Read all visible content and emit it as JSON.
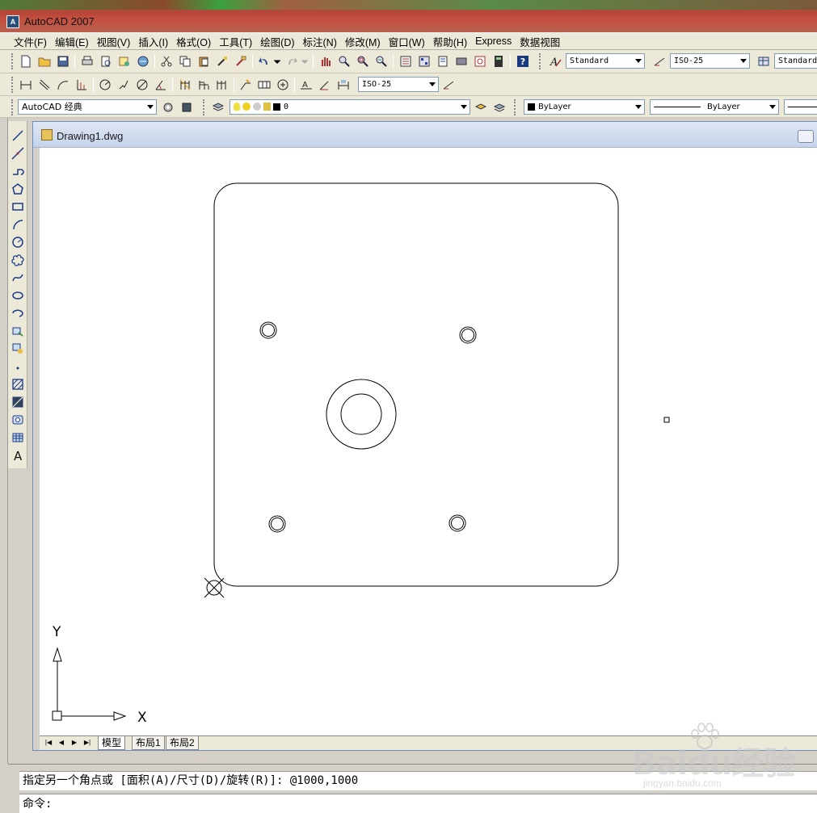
{
  "app": {
    "title": "AutoCAD 2007",
    "icon_name": "autocad-icon"
  },
  "menu": {
    "items": [
      "文件(F)",
      "编辑(E)",
      "视图(V)",
      "插入(I)",
      "格式(O)",
      "工具(T)",
      "绘图(D)",
      "标注(N)",
      "修改(M)",
      "窗口(W)",
      "帮助(H)",
      "Express",
      "数据视图"
    ]
  },
  "toolbar_styles": {
    "text_style": "Standard",
    "dim_style": "ISO-25",
    "table_style": "Standard",
    "dim_style_2": "ISO-25"
  },
  "properties": {
    "workspace": "AutoCAD 经典",
    "layer": "0",
    "color": "ByLayer",
    "linetype": "ByLayer"
  },
  "document": {
    "title": "Drawing1.dwg"
  },
  "ucs": {
    "x_label": "X",
    "y_label": "Y"
  },
  "layout_tabs": {
    "items": [
      "模型",
      "布局1",
      "布局2"
    ],
    "active": "模型"
  },
  "command": {
    "history": "指定另一个角点或 [面积(A)/尺寸(D)/旋转(R)]: @1000,1000",
    "prompt": "命令:"
  },
  "watermark": {
    "main": "Baidu经验",
    "sub": "jingyan.baidu.com"
  }
}
